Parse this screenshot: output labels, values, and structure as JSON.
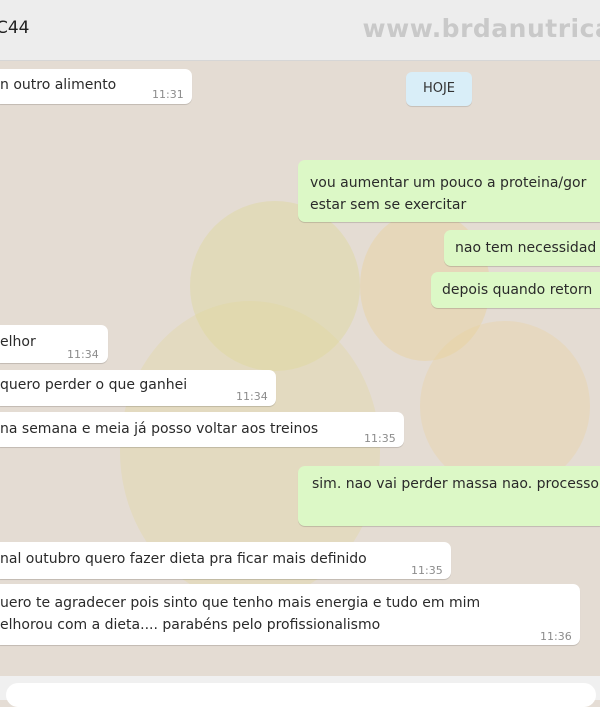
{
  "header": {
    "contact_name": "C44",
    "watermark": "www.brdanutricao"
  },
  "date_separator": "HOJE",
  "messages": [
    {
      "dir": "in",
      "text": "n outro alimento",
      "time": "11:31"
    },
    {
      "dir": "out",
      "line1": "vou aumentar um pouco a proteina/gor",
      "line2": "estar sem se exercitar"
    },
    {
      "dir": "out",
      "text": "nao tem necessidad"
    },
    {
      "dir": "out",
      "text": "depois quando retorn"
    },
    {
      "dir": "in",
      "text": "elhor",
      "time": "11:34"
    },
    {
      "dir": "in",
      "text": "quero perder o que ganhei",
      "time": "11:34"
    },
    {
      "dir": "in",
      "text": "na semana e meia já posso voltar aos treinos",
      "time": "11:35"
    },
    {
      "dir": "out",
      "text": "sim. nao vai perder massa nao. processo"
    },
    {
      "dir": "in",
      "text": "nal outubro quero fazer dieta pra ficar mais definido",
      "time": "11:35"
    },
    {
      "dir": "in",
      "line1": "uero te agradecer pois sinto que tenho mais energia e tudo em mim",
      "line2": "elhorou com a dieta.... parabéns pelo profissionalismo",
      "time": "11:36"
    }
  ]
}
